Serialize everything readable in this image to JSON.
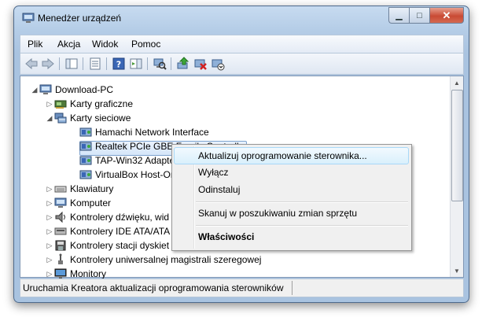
{
  "window": {
    "title": "Menedżer urządzeń"
  },
  "menu": [
    "Plik",
    "Akcja",
    "Widok",
    "Pomoc"
  ],
  "tree": [
    {
      "label": "Download-PC",
      "level": 0,
      "expander": "open",
      "icon": "computer-icon"
    },
    {
      "label": "Karty graficzne",
      "level": 1,
      "expander": "closed",
      "icon": "display-adapter-icon"
    },
    {
      "label": "Karty sieciowe",
      "level": 1,
      "expander": "open",
      "icon": "network-adapter-icon"
    },
    {
      "label": "Hamachi Network Interface",
      "level": 2,
      "expander": "none",
      "icon": "network-card-icon"
    },
    {
      "label": "Realtek PCIe GBE Family Controller",
      "level": 2,
      "expander": "none",
      "icon": "network-card-icon",
      "selected": true
    },
    {
      "label": "TAP-Win32 Adapter",
      "level": 2,
      "expander": "none",
      "icon": "network-card-icon"
    },
    {
      "label": "VirtualBox Host-Only",
      "level": 2,
      "expander": "none",
      "icon": "network-card-icon"
    },
    {
      "label": "Klawiatury",
      "level": 1,
      "expander": "closed",
      "icon": "keyboard-icon"
    },
    {
      "label": "Komputer",
      "level": 1,
      "expander": "closed",
      "icon": "computer-icon"
    },
    {
      "label": "Kontrolery dźwięku, wid",
      "level": 1,
      "expander": "closed",
      "icon": "speaker-icon"
    },
    {
      "label": "Kontrolery IDE ATA/ATA",
      "level": 1,
      "expander": "closed",
      "icon": "ide-controller-icon"
    },
    {
      "label": "Kontrolery stacji dyskiet",
      "level": 1,
      "expander": "closed",
      "icon": "floppy-controller-icon"
    },
    {
      "label": "Kontrolery uniwersalnej magistrali szeregowej",
      "level": 1,
      "expander": "closed",
      "icon": "usb-icon"
    },
    {
      "label": "Monitory",
      "level": 1,
      "expander": "closed",
      "icon": "monitor-icon"
    }
  ],
  "context_menu": {
    "update": "Aktualizuj oprogramowanie sterownika...",
    "disable": "Wyłącz",
    "uninstall": "Odinstaluj",
    "scan": "Skanuj w poszukiwaniu zmian sprzętu",
    "properties": "Właściwości"
  },
  "status": {
    "text": "Uruchamia Kreatora aktualizacji oprogramowania sterowników d"
  },
  "toolbar_icons": [
    "back-arrow-icon",
    "forward-arrow-icon",
    "show-hide-tree-icon",
    "properties-icon",
    "help-icon",
    "action-pane-icon",
    "scan-hardware-icon",
    "update-driver-icon",
    "disable-device-icon",
    "uninstall-device-icon"
  ],
  "colors": {
    "accent": "#3399ff",
    "selection": "#d5e6f9",
    "window_frame": "#a9c3e0",
    "close_button": "#c94a34"
  }
}
